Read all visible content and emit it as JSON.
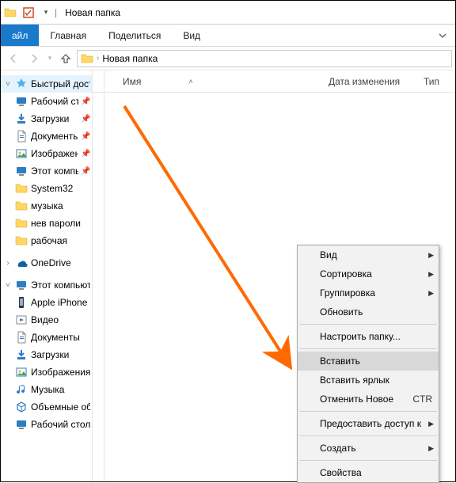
{
  "title": "Новая папка",
  "ribbon": {
    "file": "айл",
    "home": "Главная",
    "share": "Поделиться",
    "view": "Вид"
  },
  "address": {
    "crumb": "Новая папка"
  },
  "columns": {
    "name": "Имя",
    "date": "Дата изменения",
    "type": "Тип"
  },
  "sidebar": {
    "quick": "Быстрый доступ",
    "items": [
      {
        "label": "Рабочий сто…",
        "icon": "desktop",
        "pin": true
      },
      {
        "label": "Загрузки",
        "icon": "downloads",
        "pin": true
      },
      {
        "label": "Документы",
        "icon": "documents",
        "pin": true
      },
      {
        "label": "Изображени…",
        "icon": "pictures",
        "pin": true
      },
      {
        "label": "Этот компь…",
        "icon": "thispc",
        "pin": true
      },
      {
        "label": "System32",
        "icon": "folder",
        "pin": false
      },
      {
        "label": "музыка",
        "icon": "folder",
        "pin": false
      },
      {
        "label": "нев пароли",
        "icon": "folder",
        "pin": false
      },
      {
        "label": "рабочая",
        "icon": "folder",
        "pin": false
      }
    ],
    "onedrive": "OneDrive",
    "thispc": "Этот компьютер",
    "pcitems": [
      {
        "label": "Apple iPhone",
        "icon": "phone"
      },
      {
        "label": "Видео",
        "icon": "videos"
      },
      {
        "label": "Документы",
        "icon": "documents"
      },
      {
        "label": "Загрузки",
        "icon": "downloads"
      },
      {
        "label": "Изображения",
        "icon": "pictures"
      },
      {
        "label": "Музыка",
        "icon": "music"
      },
      {
        "label": "Объемные объ…",
        "icon": "3d"
      },
      {
        "label": "Рабочий стол",
        "icon": "desktop"
      }
    ]
  },
  "contextmenu": {
    "view": "Вид",
    "sort": "Сортировка",
    "group": "Группировка",
    "refresh": "Обновить",
    "customize": "Настроить папку...",
    "paste": "Вставить",
    "paste_shortcut": "Вставить ярлык",
    "undo": "Отменить Новое",
    "undo_key": "CTR",
    "give_access": "Предоставить доступ к",
    "new": "Создать",
    "properties": "Свойства"
  }
}
